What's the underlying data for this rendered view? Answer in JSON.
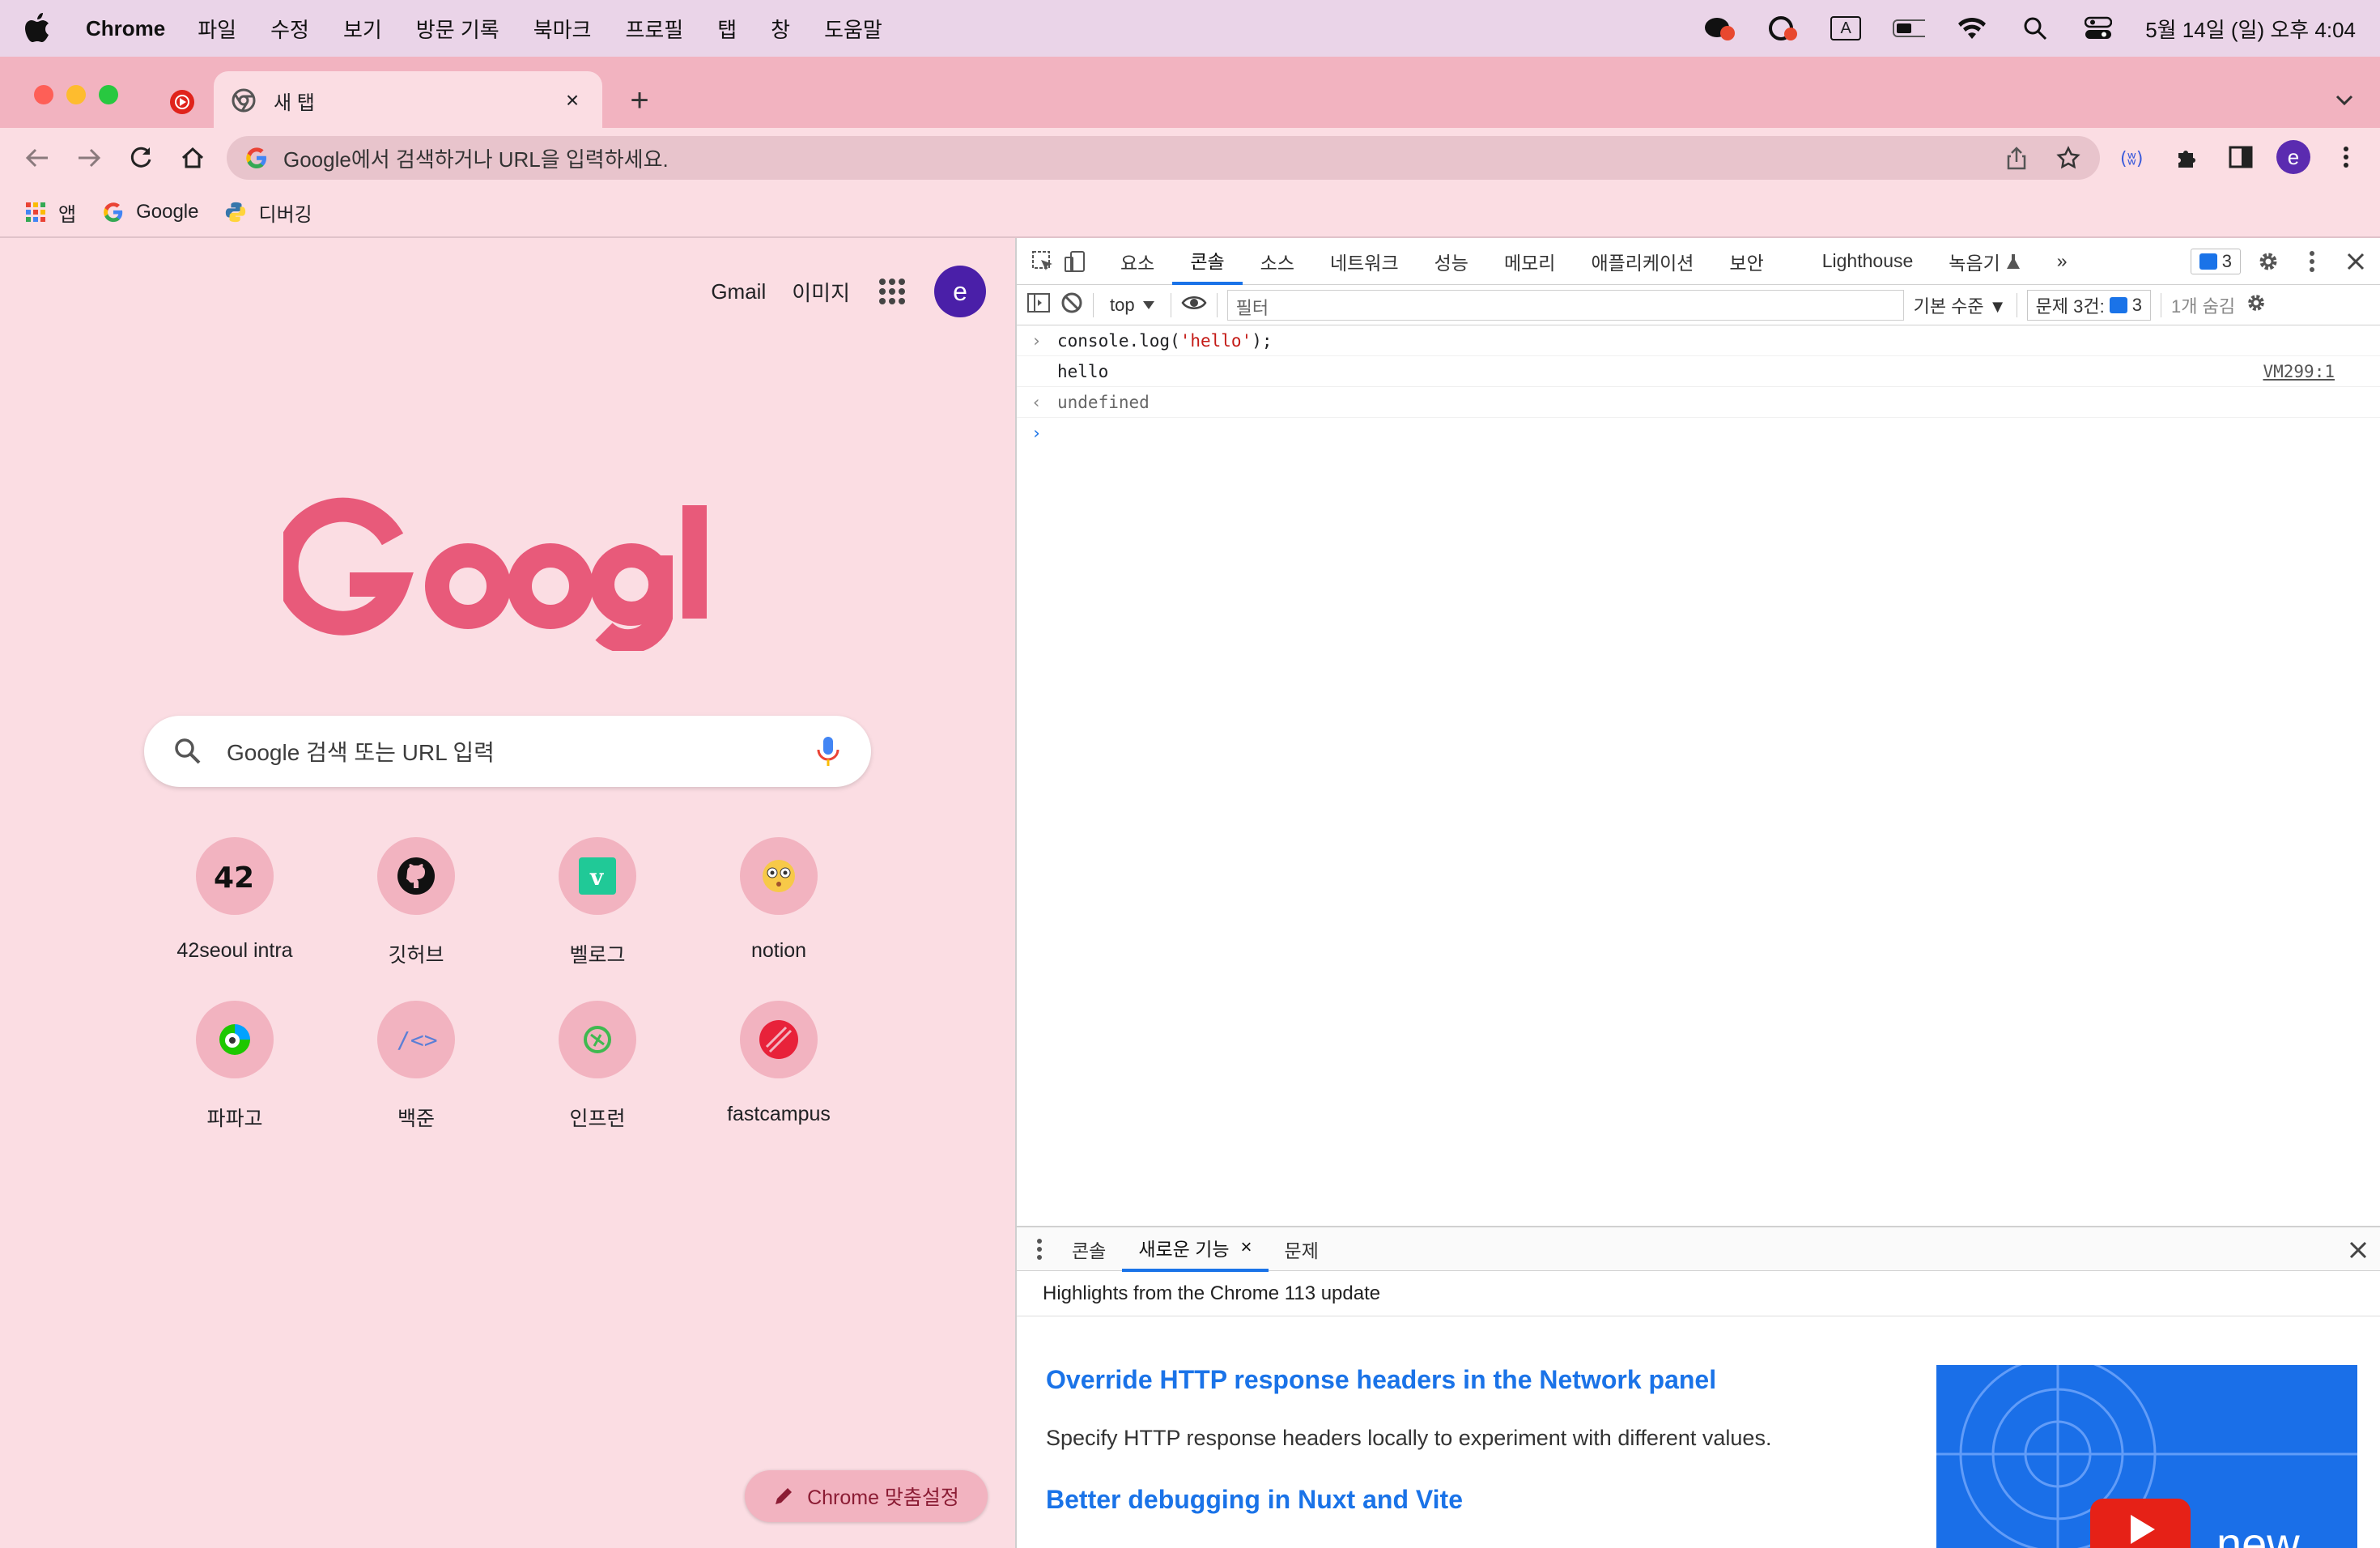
{
  "menubar": {
    "app_name": "Chrome",
    "items": [
      "파일",
      "수정",
      "보기",
      "방문 기록",
      "북마크",
      "프로필",
      "탭",
      "창",
      "도움말"
    ],
    "input_source": "A",
    "datetime": "5월 14일 (일) 오후 4:04"
  },
  "tabs": {
    "active_title": "새 탭",
    "close_glyph": "×",
    "new_tab_glyph": "+"
  },
  "omnibox": {
    "placeholder": "Google에서 검색하거나 URL을 입력하세요."
  },
  "profile": {
    "initial": "e"
  },
  "bookmarks": [
    {
      "label": "앱",
      "icon": "apps-grid-icon"
    },
    {
      "label": "Google",
      "icon": "google-g-icon"
    },
    {
      "label": "디버깅",
      "icon": "python-icon"
    }
  ],
  "ntp": {
    "gmail": "Gmail",
    "images": "이미지",
    "avatar_initial": "e",
    "search_placeholder": "Google 검색 또는 URL 입력",
    "shortcuts": [
      {
        "label": "42seoul intra",
        "icon": "42-icon"
      },
      {
        "label": "깃허브",
        "icon": "github-icon"
      },
      {
        "label": "벨로그",
        "icon": "velog-icon"
      },
      {
        "label": "notion",
        "icon": "notion-emoji-icon"
      },
      {
        "label": "파파고",
        "icon": "papago-icon"
      },
      {
        "label": "백준",
        "icon": "code-icon"
      },
      {
        "label": "인프런",
        "icon": "inflearn-icon"
      },
      {
        "label": "fastcampus",
        "icon": "fastcampus-icon"
      }
    ],
    "customize": "Chrome 맞춤설정"
  },
  "devtools": {
    "tabs": [
      "요소",
      "콘솔",
      "소스",
      "네트워크",
      "성능",
      "메모리",
      "애플리케이션",
      "보안",
      "Lighthouse",
      "녹음기"
    ],
    "active_tab": "콘솔",
    "more_glyph": "»",
    "issues_count": "3",
    "context": "top",
    "filter_placeholder": "필터",
    "level": "기본 수준 ▼",
    "issues_label": "문제 3건:",
    "hidden": "1개 숨김",
    "console": {
      "input_prefix": "console.log(",
      "input_string": "'hello'",
      "input_suffix": ");",
      "output": "hello",
      "source": "VM299:1",
      "result": "undefined"
    },
    "drawer": {
      "tabs": [
        "콘솔",
        "새로운 기능",
        "문제"
      ],
      "active": "새로운 기능",
      "heading": "Highlights from the Chrome 113 update",
      "items": [
        {
          "title": "Override HTTP response headers in the Network panel",
          "desc": "Specify HTTP response headers locally to experiment with different values."
        },
        {
          "title": "Better debugging in Nuxt and Vite",
          "desc": ""
        }
      ],
      "image_text": "new"
    }
  },
  "colors": {
    "menubar_bg": "#ead4e8",
    "tabstrip_bg": "#f2b3c0",
    "page_bg": "#fbdde3",
    "google_logo": "#e85a7a",
    "link_blue": "#1a73e8"
  }
}
